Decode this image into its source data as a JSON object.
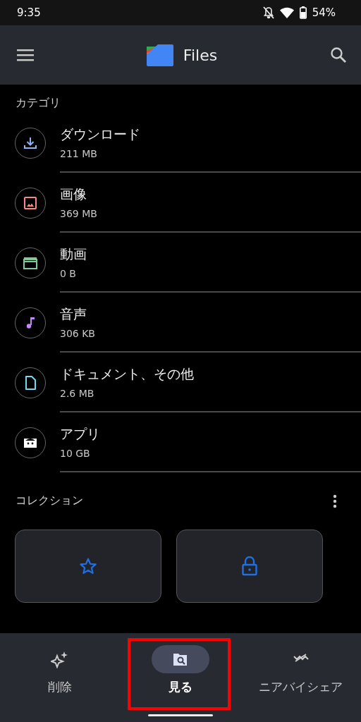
{
  "status_bar": {
    "time": "9:35",
    "battery": "54%"
  },
  "app_bar": {
    "title": "Files"
  },
  "categories": {
    "title": "カテゴリ",
    "items": [
      {
        "kind": "download",
        "name": "ダウンロード",
        "size": "211 MB",
        "color": "#8ab4f8"
      },
      {
        "kind": "image",
        "name": "画像",
        "size": "369 MB",
        "color": "#f28b82"
      },
      {
        "kind": "video",
        "name": "動画",
        "size": "0 B",
        "color": "#81c995"
      },
      {
        "kind": "audio",
        "name": "音声",
        "size": "306 KB",
        "color": "#c58af9"
      },
      {
        "kind": "document",
        "name": "ドキュメント、その他",
        "size": "2.6 MB",
        "color": "#78d9ec"
      },
      {
        "kind": "app",
        "name": "アプリ",
        "size": "10 GB",
        "color": "#ffffff"
      }
    ]
  },
  "collections": {
    "title": "コレクション",
    "cards": [
      {
        "kind": "star"
      },
      {
        "kind": "lock"
      }
    ]
  },
  "bottom_nav": [
    {
      "kind": "clean",
      "label": "削除",
      "selected": false,
      "highlighted": false
    },
    {
      "kind": "browse",
      "label": "見る",
      "selected": true,
      "highlighted": true
    },
    {
      "kind": "share",
      "label": "ニアバイシェア",
      "selected": false,
      "highlighted": false
    }
  ]
}
